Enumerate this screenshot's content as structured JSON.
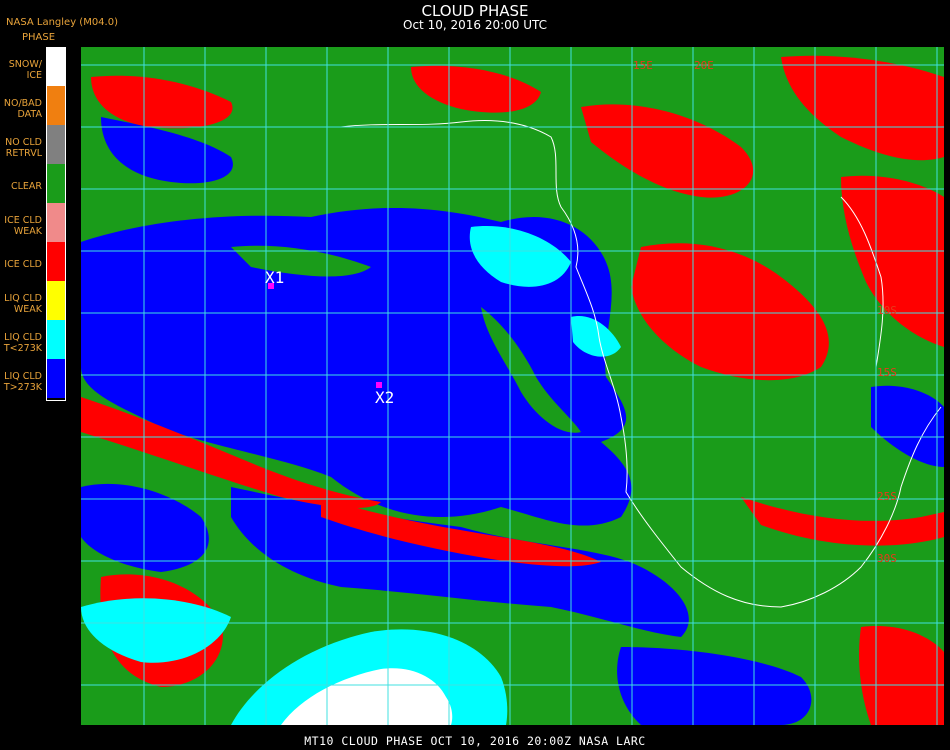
{
  "header": {
    "title": "CLOUD PHASE",
    "subtitle": "Oct 10, 2016 20:00 UTC",
    "provider": "NASA Langley (M04.0)",
    "legend_title": "PHASE"
  },
  "legend": [
    {
      "line1": "SNOW/",
      "line2": "ICE",
      "color": "#ffffff"
    },
    {
      "line1": "NO/BAD",
      "line2": "DATA",
      "color": "#f07f10"
    },
    {
      "line1": "NO CLD",
      "line2": "RETRVL",
      "color": "#808080"
    },
    {
      "line1": "CLEAR",
      "line2": "",
      "color": "#1a9c1a"
    },
    {
      "line1": "ICE CLD",
      "line2": "WEAK",
      "color": "#f08a8a"
    },
    {
      "line1": "ICE CLD",
      "line2": "",
      "color": "#ff0000"
    },
    {
      "line1": "LIQ CLD",
      "line2": "WEAK",
      "color": "#ffff00"
    },
    {
      "line1": "LIQ CLD",
      "line2": "T<273K",
      "color": "#00ffff"
    },
    {
      "line1": "LIQ CLD",
      "line2": "T>273K",
      "color": "#0000ff"
    }
  ],
  "map": {
    "lon_labels": [
      "15E",
      "20E"
    ],
    "lat_labels": [
      "10S",
      "15S",
      "25S",
      "30S"
    ],
    "markers": [
      {
        "label": "X1",
        "color": "#ff00ff"
      },
      {
        "label": "X2",
        "color": "#ff00ff"
      }
    ],
    "colors": {
      "grid": "#40e0e0",
      "coast": "#ffffff",
      "ocean_liq": "#0000ff",
      "clear": "#1a9c1a",
      "ice": "#ff0000",
      "liq_cold": "#00ffff"
    }
  },
  "footer": "MT10  CLOUD PHASE   OCT 10, 2016 20:00Z   NASA LARC"
}
